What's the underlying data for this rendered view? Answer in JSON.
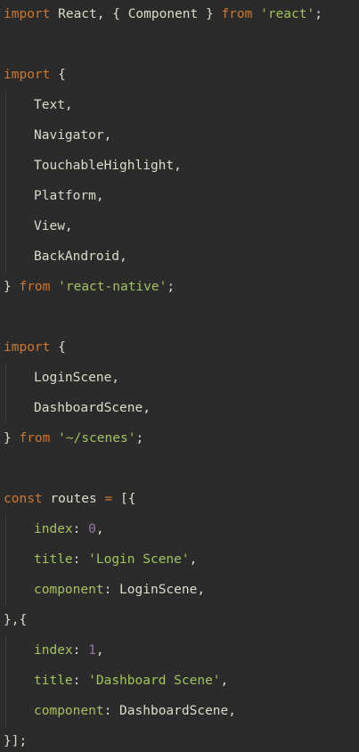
{
  "lines": [
    {
      "t": [
        {
          "c": "kw",
          "v": "import"
        },
        {
          "c": "ident",
          "v": " React, { Component } "
        },
        {
          "c": "kw",
          "v": "from"
        },
        {
          "c": "punc",
          "v": " "
        },
        {
          "c": "str",
          "v": "'react'"
        },
        {
          "c": "punc",
          "v": ";"
        }
      ]
    },
    {
      "t": []
    },
    {
      "t": [
        {
          "c": "kw",
          "v": "import"
        },
        {
          "c": "punc",
          "v": " {"
        }
      ]
    },
    {
      "i": 1,
      "t": [
        {
          "c": "ident",
          "v": "Text,"
        }
      ]
    },
    {
      "i": 1,
      "t": [
        {
          "c": "ident",
          "v": "Navigator,"
        }
      ]
    },
    {
      "i": 1,
      "t": [
        {
          "c": "ident",
          "v": "TouchableHighlight,"
        }
      ]
    },
    {
      "i": 1,
      "t": [
        {
          "c": "ident",
          "v": "Platform,"
        }
      ]
    },
    {
      "i": 1,
      "t": [
        {
          "c": "ident",
          "v": "View,"
        }
      ]
    },
    {
      "i": 1,
      "t": [
        {
          "c": "ident",
          "v": "BackAndroid,"
        }
      ]
    },
    {
      "t": [
        {
          "c": "punc",
          "v": "} "
        },
        {
          "c": "kw",
          "v": "from"
        },
        {
          "c": "punc",
          "v": " "
        },
        {
          "c": "str",
          "v": "'react-native'"
        },
        {
          "c": "punc",
          "v": ";"
        }
      ]
    },
    {
      "t": []
    },
    {
      "t": [
        {
          "c": "kw",
          "v": "import"
        },
        {
          "c": "punc",
          "v": " {"
        }
      ]
    },
    {
      "i": 1,
      "t": [
        {
          "c": "ident",
          "v": "LoginScene,"
        }
      ]
    },
    {
      "i": 1,
      "t": [
        {
          "c": "ident",
          "v": "DashboardScene,"
        }
      ]
    },
    {
      "t": [
        {
          "c": "punc",
          "v": "} "
        },
        {
          "c": "kw",
          "v": "from"
        },
        {
          "c": "punc",
          "v": " "
        },
        {
          "c": "str",
          "v": "'~/scenes'"
        },
        {
          "c": "punc",
          "v": ";"
        }
      ]
    },
    {
      "t": []
    },
    {
      "t": [
        {
          "c": "kw",
          "v": "const"
        },
        {
          "c": "ident",
          "v": " routes "
        },
        {
          "c": "kw",
          "v": "="
        },
        {
          "c": "punc",
          "v": " [{"
        }
      ]
    },
    {
      "i": 1,
      "t": [
        {
          "c": "prop",
          "v": "index"
        },
        {
          "c": "punc",
          "v": ": "
        },
        {
          "c": "num",
          "v": "0"
        },
        {
          "c": "punc",
          "v": ","
        }
      ]
    },
    {
      "i": 1,
      "t": [
        {
          "c": "prop",
          "v": "title"
        },
        {
          "c": "punc",
          "v": ": "
        },
        {
          "c": "str",
          "v": "'Login Scene'"
        },
        {
          "c": "punc",
          "v": ","
        }
      ]
    },
    {
      "i": 1,
      "t": [
        {
          "c": "prop",
          "v": "component"
        },
        {
          "c": "punc",
          "v": ": "
        },
        {
          "c": "ident",
          "v": "LoginScene,"
        }
      ]
    },
    {
      "t": [
        {
          "c": "punc",
          "v": "},{"
        }
      ]
    },
    {
      "i": 1,
      "t": [
        {
          "c": "prop",
          "v": "index"
        },
        {
          "c": "punc",
          "v": ": "
        },
        {
          "c": "num",
          "v": "1"
        },
        {
          "c": "punc",
          "v": ","
        }
      ]
    },
    {
      "i": 1,
      "t": [
        {
          "c": "prop",
          "v": "title"
        },
        {
          "c": "punc",
          "v": ": "
        },
        {
          "c": "str",
          "v": "'Dashboard Scene'"
        },
        {
          "c": "punc",
          "v": ","
        }
      ]
    },
    {
      "i": 1,
      "t": [
        {
          "c": "prop",
          "v": "component"
        },
        {
          "c": "punc",
          "v": ": "
        },
        {
          "c": "ident",
          "v": "DashboardScene,"
        }
      ]
    },
    {
      "t": [
        {
          "c": "punc",
          "v": "}];"
        }
      ]
    }
  ]
}
